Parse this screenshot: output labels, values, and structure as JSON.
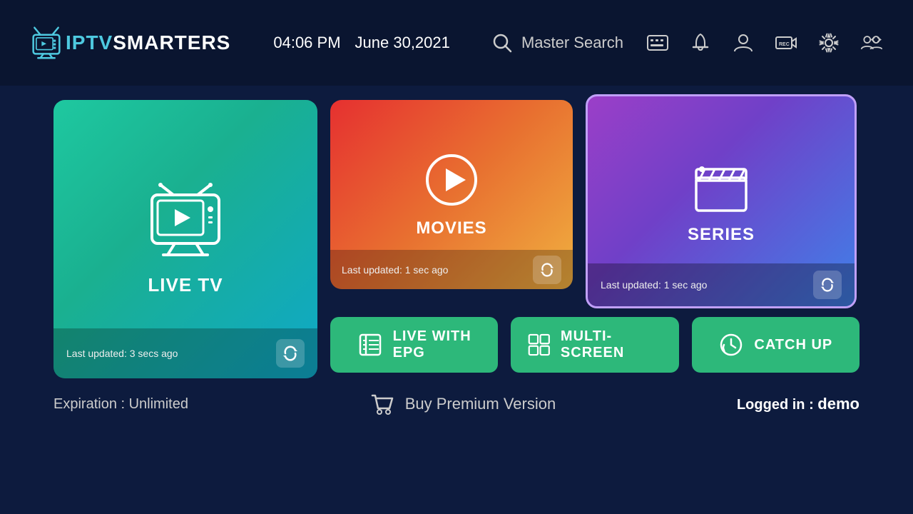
{
  "header": {
    "logo_iptv": "IPTV",
    "logo_smarters": "SMARTERS",
    "time": "04:06 PM",
    "date": "June 30,2021",
    "search_label": "Master Search",
    "icons": {
      "epg": "epg-icon",
      "bell": "bell-icon",
      "profile": "profile-icon",
      "rec": "rec-icon",
      "settings": "settings-icon",
      "switch_user": "switch-user-icon"
    }
  },
  "cards": {
    "livetv": {
      "title": "LIVE TV",
      "last_updated": "Last updated: 3 secs ago"
    },
    "movies": {
      "title": "MOVIES",
      "last_updated": "Last updated: 1 sec ago"
    },
    "series": {
      "title": "SERIES",
      "last_updated": "Last updated: 1 sec ago"
    }
  },
  "buttons": {
    "live_with_epg": "LIVE WITH\nEPG",
    "live_with_epg_line1": "LIVE WITH",
    "live_with_epg_line2": "EPG",
    "multiscreen": "MULTI-SCREEN",
    "catchup": "CATCH UP"
  },
  "footer": {
    "expiration": "Expiration : Unlimited",
    "buy_premium": "Buy Premium Version",
    "logged_in_label": "Logged in :",
    "logged_in_user": "demo"
  }
}
